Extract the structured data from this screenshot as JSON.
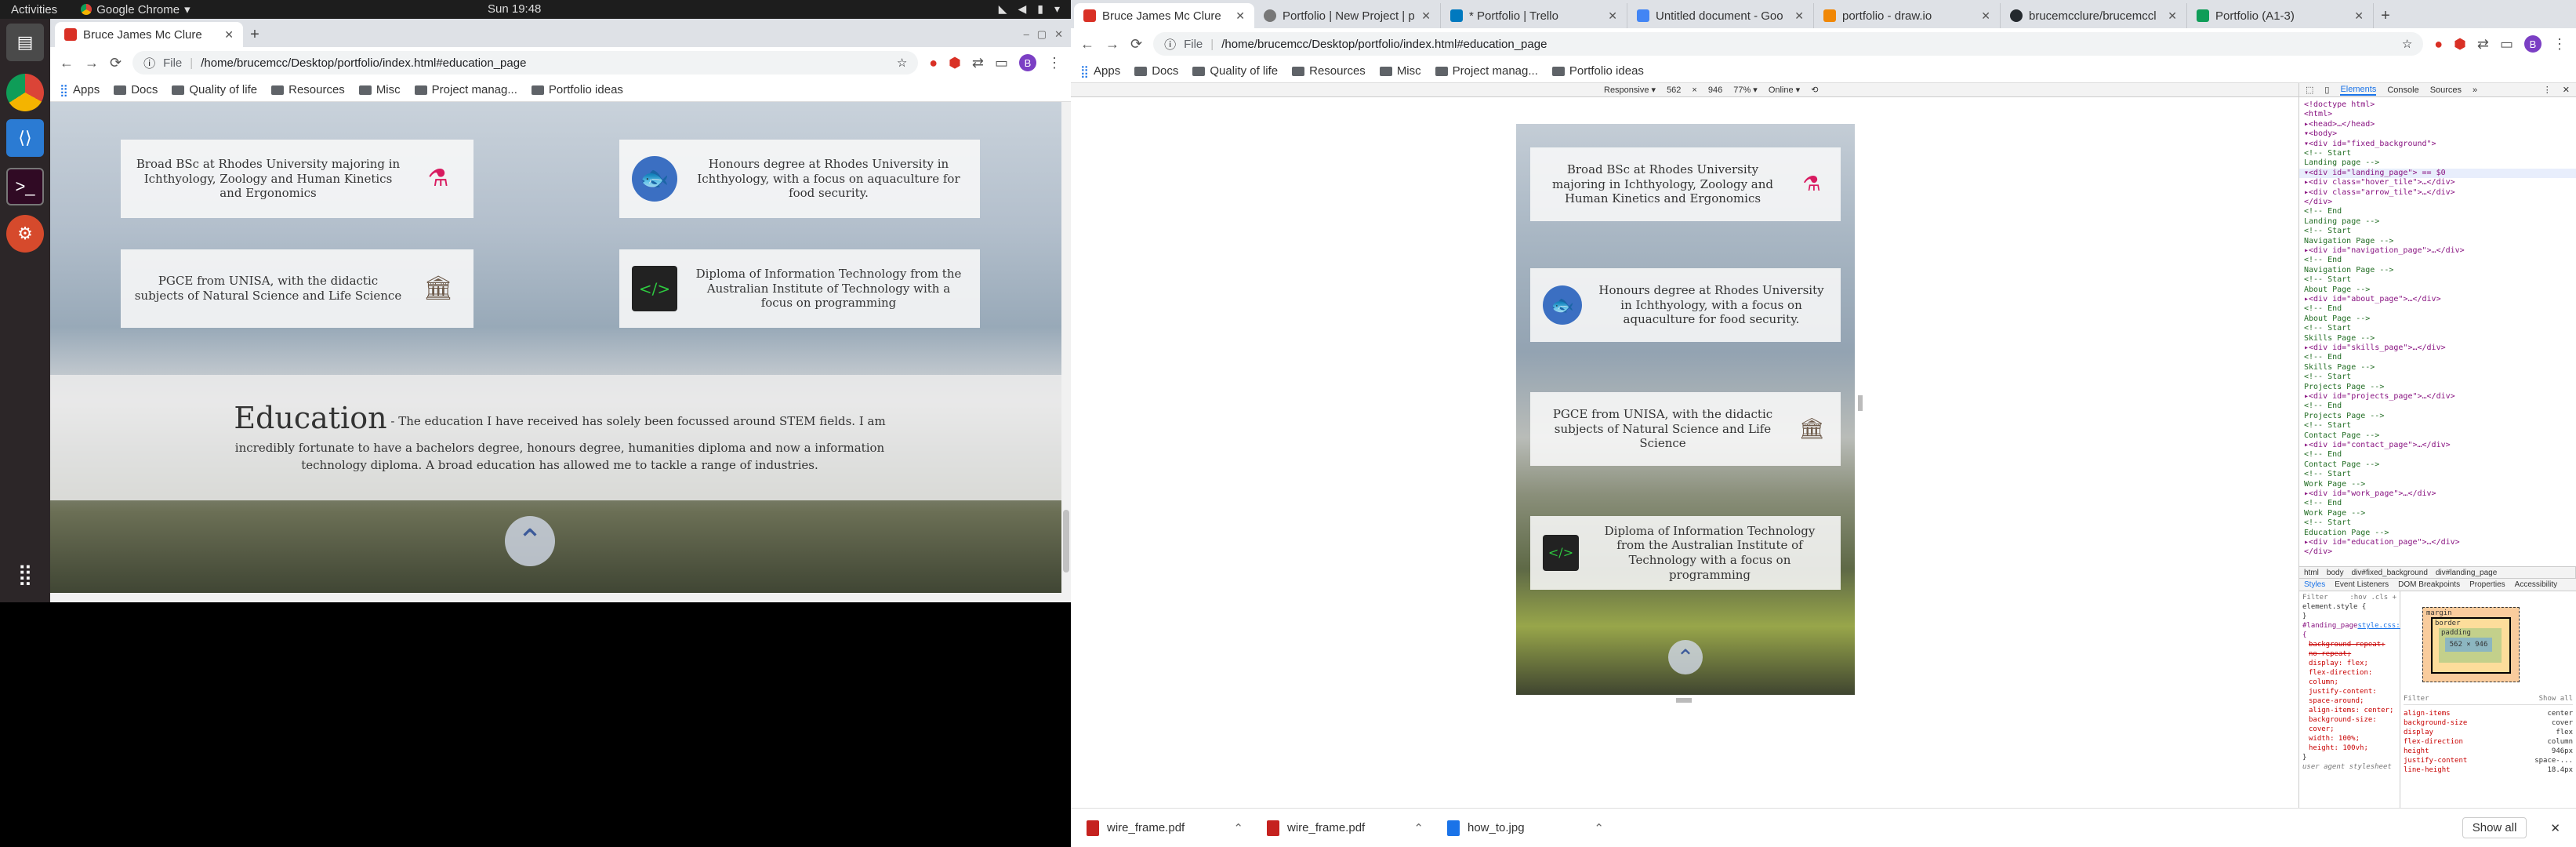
{
  "topbar": {
    "activities": "Activities",
    "app": "Google Chrome",
    "clock": "Sun 19:48"
  },
  "left": {
    "tabs": [
      {
        "label": "Bruce James Mc Clure"
      }
    ],
    "url_scheme": "File",
    "url": "/home/brucemcc/Desktop/portfolio/index.html#education_page",
    "bookmarks": [
      "Apps",
      "Docs",
      "Quality of life",
      "Resources",
      "Misc",
      "Project manag...",
      "Portfolio ideas"
    ],
    "cards": [
      "Broad BSc at Rhodes University majoring in Ichthyology, Zoology and Human Kinetics and Ergonomics",
      "Honours degree at Rhodes University in Ichthyology, with a focus on aquaculture for food security.",
      "PGCE from UNISA, with the didactic subjects of Natural Science and Life Science",
      "Diploma of Information Technology from the Australian Institute of Technology with a focus on programming"
    ],
    "education_title": "Education",
    "education_text": "- The education I have received has solely been focussed around STEM fields. I am incredibly fortunate to have a bachelors degree, honours degree, humanities diploma and now a information technology diploma. A broad education has allowed me to tackle a range of industries."
  },
  "right": {
    "tabs": [
      {
        "label": "Bruce James Mc Clure",
        "color": "#d93025"
      },
      {
        "label": "Portfolio | New Project | p",
        "color": "#777777"
      },
      {
        "label": "* Portfolio | Trello",
        "color": "#0079bf"
      },
      {
        "label": "Untitled document - Goo",
        "color": "#4285f4"
      },
      {
        "label": "portfolio - draw.io",
        "color": "#f08705"
      },
      {
        "label": "brucemcclure/brucemccl",
        "color": "#24292e"
      },
      {
        "label": "Portfolio (A1-3)",
        "color": "#0f9d58"
      }
    ],
    "url_scheme": "File",
    "url": "/home/brucemcc/Desktop/portfolio/index.html#education_page",
    "bookmarks": [
      "Apps",
      "Docs",
      "Quality of life",
      "Resources",
      "Misc",
      "Project manag...",
      "Portfolio ideas"
    ],
    "device_bar": [
      "Responsive ▾",
      "562",
      "×",
      "946",
      "77% ▾",
      "Online ▾"
    ],
    "devtools_tabs": [
      "Elements",
      "Console",
      "Sources",
      "»"
    ],
    "dom_lines": [
      "<!doctype html>",
      "<html>",
      "▸<head>…</head>",
      "▾<body>",
      "  ▾<div id=\"fixed_background\">",
      "    <!-- Start",
      "    Landing page -->",
      "  ▾<div id=\"landing_page\"> == $0",
      "    ▸<div class=\"hover_tile\">…</div>",
      "    ▸<div class=\"arrow_tile\">…</div>",
      "    </div>",
      "    <!-- End",
      "    Landing page -->",
      "    <!-- Start",
      "    Navigation Page -->",
      "  ▸<div id=\"navigation_page\">…</div>",
      "    <!-- End",
      "    Navigation Page -->",
      "    <!-- Start",
      "    About Page -->",
      "  ▸<div id=\"about_page\">…</div>",
      "    <!-- End",
      "    About Page -->",
      "    <!-- Start",
      "    Skills Page -->",
      "  ▸<div id=\"skills_page\">…</div>",
      "    <!-- End",
      "    Skills Page -->",
      "    <!-- Start",
      "    Projects Page -->",
      "  ▸<div id=\"projects_page\">…</div>",
      "    <!-- End",
      "    Projects Page -->",
      "    <!-- Start",
      "    Contact Page -->",
      "  ▸<div id=\"contact_page\">…</div>",
      "    <!-- End",
      "    Contact Page -->",
      "    <!-- Start",
      "    Work Page -->",
      "  ▸<div id=\"work_page\">…</div>",
      "    <!-- End",
      "    Work Page -->",
      "    <!-- Start",
      "    Education Page -->",
      "  ▸<div id=\"education_page\">…</div>",
      "    </div>"
    ],
    "breadcrumb": [
      "html",
      "body",
      "div#fixed_background",
      "div#landing_page"
    ],
    "styles_tabs": [
      "Styles",
      "Event Listeners",
      "DOM Breakpoints",
      "Properties",
      "Accessibility"
    ],
    "filter": "Filter",
    "hov_cls": ":hov  .cls  +",
    "element_style": "element.style {",
    "css_rule": "#landing_page {",
    "css_source": "style.css:12",
    "css_props": [
      "background-repeat: no-repeat;",
      "display: flex;",
      "flex-direction: column;",
      "justify-content: space-around;",
      "align-items: center;",
      "background-size: cover;",
      "width: 100%;",
      "height: 100vh;"
    ],
    "user_agent": "user agent stylesheet",
    "box_model": {
      "margin": "margin",
      "border": "border",
      "padding": "padding",
      "content": "562 × 946"
    },
    "computed": [
      [
        "align-items",
        "center"
      ],
      [
        "background-size",
        "cover"
      ],
      [
        "display",
        "flex"
      ],
      [
        "flex-direction",
        "column"
      ],
      [
        "height",
        "946px"
      ],
      [
        "justify-content",
        "space-..."
      ],
      [
        "line-height",
        "18.4px"
      ]
    ],
    "filter2": "Filter",
    "show_all": "Show all"
  },
  "downloads": {
    "items": [
      "wire_frame.pdf",
      "wire_frame.pdf",
      "how_to.jpg"
    ],
    "show_all": "Show all"
  }
}
